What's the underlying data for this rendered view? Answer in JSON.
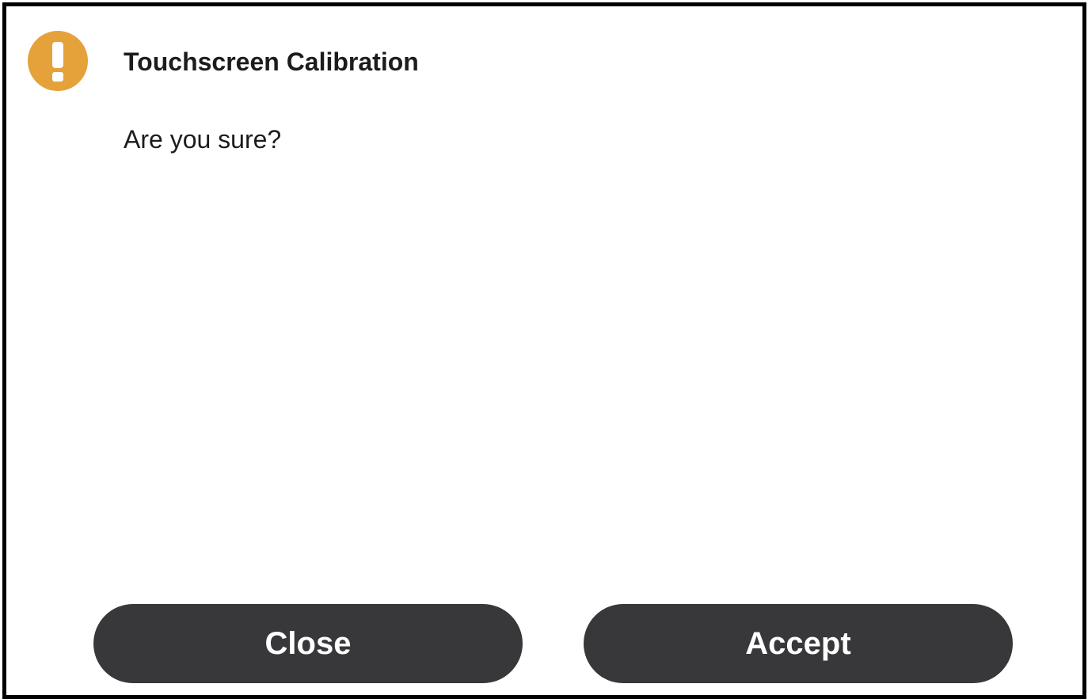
{
  "dialog": {
    "title": "Touchscreen Calibration",
    "message": "Are you sure?",
    "icon": "warning-exclamation-icon",
    "icon_color": "#e5a13a"
  },
  "buttons": {
    "close_label": "Close",
    "accept_label": "Accept",
    "button_color": "#38383b"
  }
}
